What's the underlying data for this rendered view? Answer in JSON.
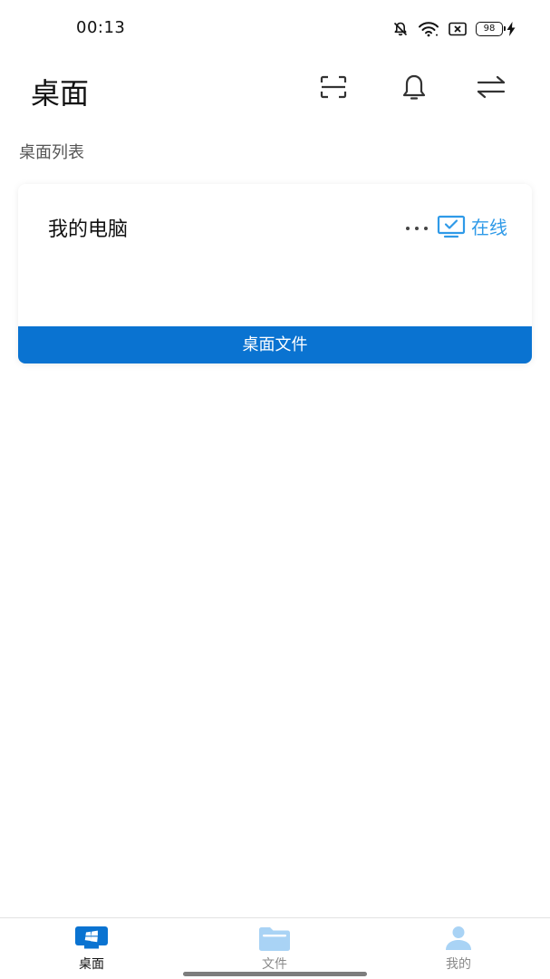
{
  "status_bar": {
    "time": "00:13",
    "battery_level": "98",
    "icons": [
      "bell-off-icon",
      "wifi-icon",
      "close-box-icon",
      "battery-icon",
      "charging-icon"
    ]
  },
  "header": {
    "title": "桌面",
    "actions": [
      "scan-icon",
      "bell-icon",
      "swap-icon"
    ]
  },
  "section": {
    "label": "桌面列表"
  },
  "desktops": [
    {
      "name": "我的电脑",
      "status": "在线",
      "button_label": "桌面文件"
    }
  ],
  "colors": {
    "accent": "#0a73d1",
    "online": "#2f9ae8",
    "nav_inactive_icon": "#a9d3f5"
  },
  "bottom_nav": {
    "items": [
      {
        "label": "桌面",
        "icon": "desktop-icon",
        "active": true
      },
      {
        "label": "文件",
        "icon": "folder-icon",
        "active": false
      },
      {
        "label": "我的",
        "icon": "user-icon",
        "active": false
      }
    ]
  }
}
